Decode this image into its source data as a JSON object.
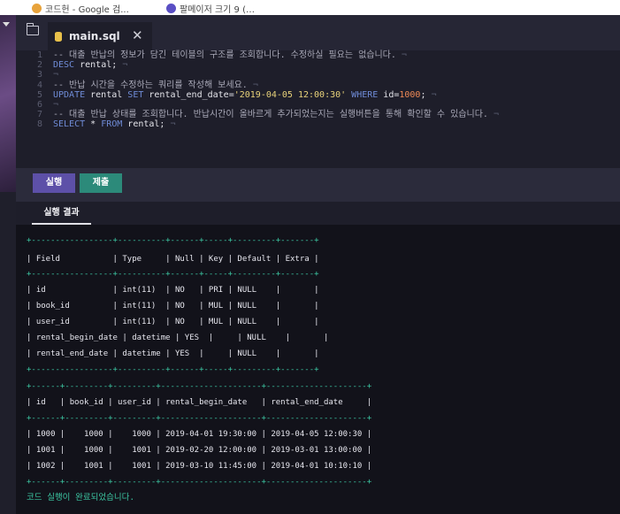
{
  "browser": {
    "bookmarks": [
      {
        "label": "코드헌 - Google 검...",
        "color": "#e8a33b"
      },
      {
        "label": "팔메이저 크기 9 (…",
        "color": "#5a4fc4"
      }
    ]
  },
  "editor": {
    "file_tab": "main.sql",
    "close_glyph": "✕",
    "lines": [
      {
        "num": "1",
        "tokens": [
          {
            "t": "-- 대출 반납의 정보가 담긴 테이블의 구조를 조회합니다. 수정하실 필요는 없습니다.",
            "c": "comment"
          },
          {
            "t": " ¬",
            "c": "ws"
          }
        ]
      },
      {
        "num": "2",
        "tokens": [
          {
            "t": "DESC",
            "c": "kw"
          },
          {
            "t": " rental;",
            "c": "id"
          },
          {
            "t": " ¬",
            "c": "ws"
          }
        ]
      },
      {
        "num": "3",
        "tokens": [
          {
            "t": "¬",
            "c": "ws"
          }
        ]
      },
      {
        "num": "4",
        "tokens": [
          {
            "t": "-- 반납 시간을 수정하는 쿼리를 작성해 보세요.",
            "c": "comment"
          },
          {
            "t": " ¬",
            "c": "ws"
          }
        ]
      },
      {
        "num": "5",
        "tokens": [
          {
            "t": "UPDATE",
            "c": "kw"
          },
          {
            "t": " rental ",
            "c": "id"
          },
          {
            "t": "SET",
            "c": "kw"
          },
          {
            "t": " rental_end_date=",
            "c": "id"
          },
          {
            "t": "'2019-04-05 12:00:30'",
            "c": "str"
          },
          {
            "t": " WHERE",
            "c": "kw"
          },
          {
            "t": " id=",
            "c": "id"
          },
          {
            "t": "1000",
            "c": "num"
          },
          {
            "t": ";",
            "c": "id"
          },
          {
            "t": " ¬",
            "c": "ws"
          }
        ]
      },
      {
        "num": "6",
        "tokens": [
          {
            "t": "¬",
            "c": "ws"
          }
        ]
      },
      {
        "num": "7",
        "tokens": [
          {
            "t": "-- 대출 반납 상태를 조회합니다. 반납시간이 올바르게 추가되었는지는 실행버튼을 통해 확인할 수 있습니다.",
            "c": "comment"
          },
          {
            "t": " ¬",
            "c": "ws"
          }
        ]
      },
      {
        "num": "8",
        "tokens": [
          {
            "t": "SELECT",
            "c": "kw"
          },
          {
            "t": " * ",
            "c": "id"
          },
          {
            "t": "FROM",
            "c": "kw"
          },
          {
            "t": " rental;",
            "c": "id"
          },
          {
            "t": " ¬",
            "c": "ws"
          }
        ]
      }
    ]
  },
  "actions": {
    "run_label": "실행",
    "submit_label": "제출"
  },
  "result_tab": "실행 결과",
  "output": {
    "lines": [
      {
        "text": "+-----------------+----------+------+-----+---------+-------+",
        "kind": "border"
      },
      {
        "text": "| Field           | Type     | Null | Key | Default | Extra |",
        "kind": "text"
      },
      {
        "text": "+-----------------+----------+------+-----+---------+-------+",
        "kind": "border"
      },
      {
        "text": "| id              | int(11)  | NO   | PRI | NULL    |       |",
        "kind": "text"
      },
      {
        "text": "| book_id         | int(11)  | NO   | MUL | NULL    |       |",
        "kind": "text"
      },
      {
        "text": "| user_id         | int(11)  | NO   | MUL | NULL    |       |",
        "kind": "text"
      },
      {
        "text": "| rental_begin_date | datetime | YES  |     | NULL    |       |",
        "kind": "text"
      },
      {
        "text": "| rental_end_date | datetime | YES  |     | NULL    |       |",
        "kind": "text"
      },
      {
        "text": "+-----------------+----------+------+-----+---------+-------+",
        "kind": "border"
      },
      {
        "text": "+------+---------+---------+---------------------+---------------------+",
        "kind": "border"
      },
      {
        "text": "| id   | book_id | user_id | rental_begin_date   | rental_end_date     |",
        "kind": "text"
      },
      {
        "text": "+------+---------+---------+---------------------+---------------------+",
        "kind": "border"
      },
      {
        "text": "| 1000 |    1000 |    1000 | 2019-04-01 19:30:00 | 2019-04-05 12:00:30 |",
        "kind": "text"
      },
      {
        "text": "| 1001 |    1000 |    1001 | 2019-02-20 12:00:00 | 2019-03-01 13:00:00 |",
        "kind": "text"
      },
      {
        "text": "| 1002 |    1001 |    1001 | 2019-03-10 11:45:00 | 2019-04-01 10:10:10 |",
        "kind": "text"
      },
      {
        "text": "+------+---------+---------+---------------------+---------------------+",
        "kind": "border"
      }
    ],
    "success_message": "코드 실행이 완료되었습니다."
  },
  "colors": {
    "accent_run": "#5d50a8",
    "accent_submit": "#2c8a7a",
    "terminal_green": "#3cc7a3"
  }
}
